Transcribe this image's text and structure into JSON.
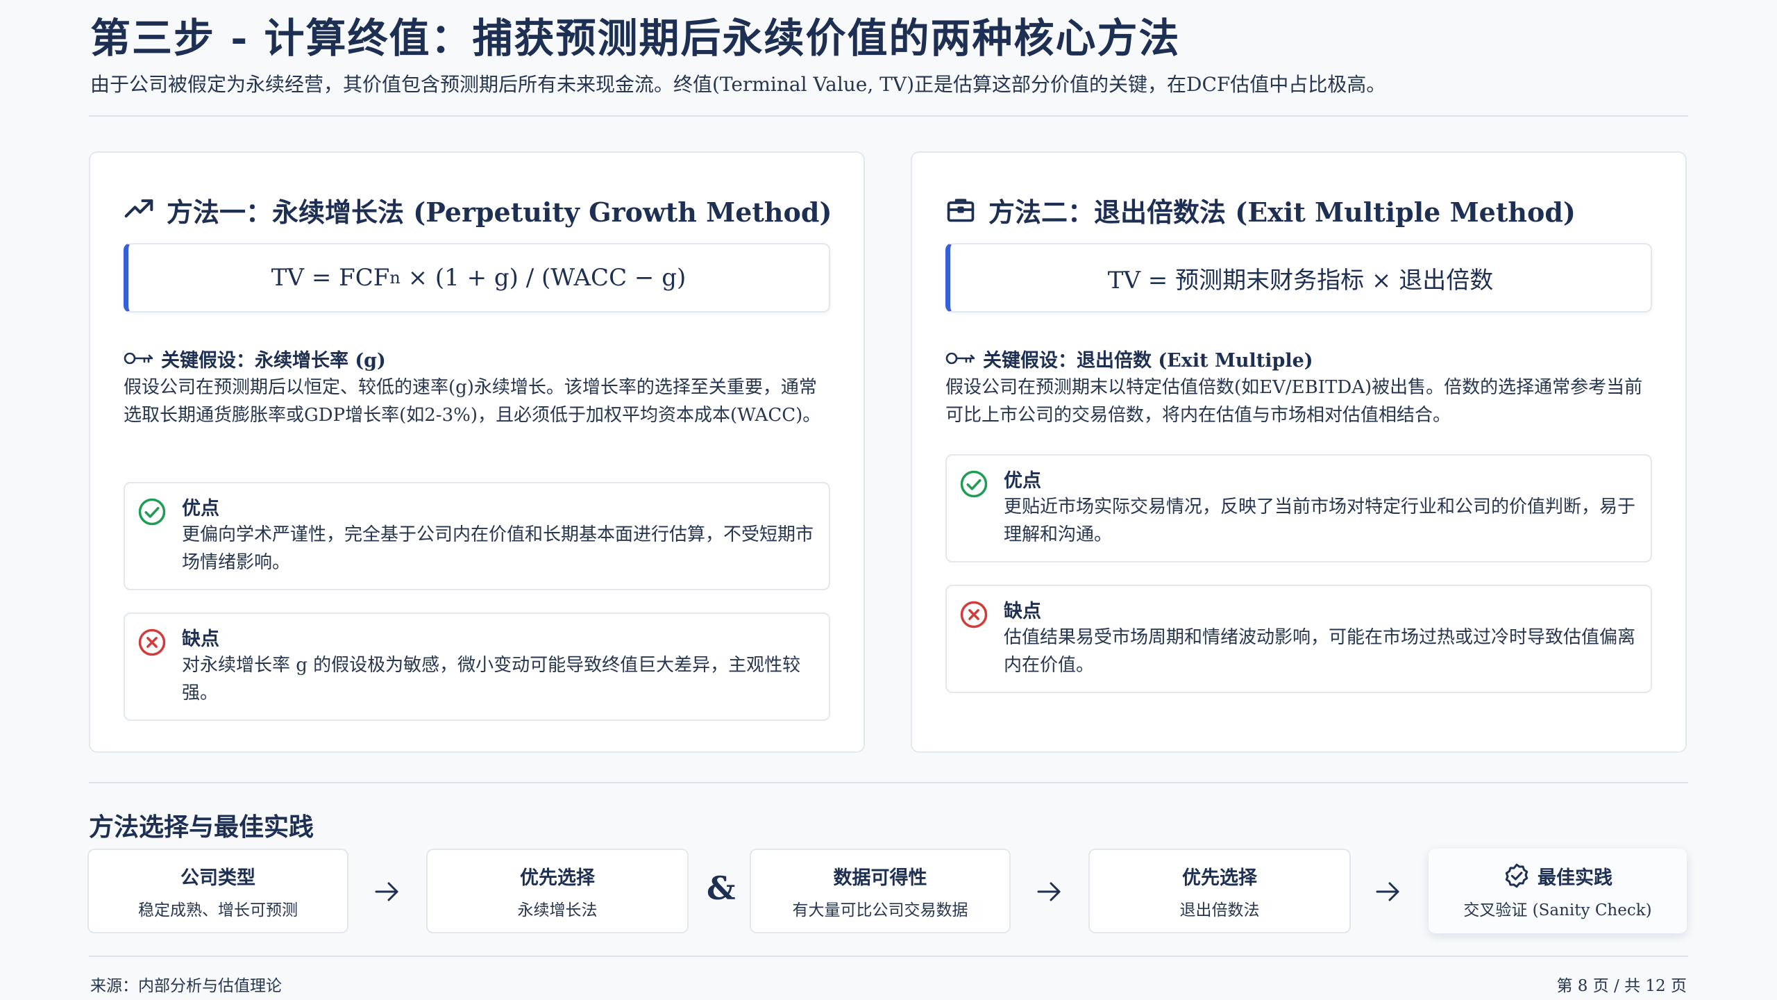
{
  "header": {
    "title": "第三步 - 计算终值：捕获预测期后永续价值的两种核心方法",
    "subtitle": "由于公司被假定为永续经营，其价值包含预测期后所有未来现金流。终值(Terminal Value, TV)正是估算这部分价值的关键，在DCF估值中占比极高。"
  },
  "method1": {
    "icon": "trending-up-icon",
    "title": "方法一：永续增长法 (Perpetuity Growth Method)",
    "formula_pre": "TV = FCF",
    "formula_sub": "n",
    "formula_post": " × (1 + g) / (WACC − g)",
    "assumption_label": "关键假设：永续增长率 (g)",
    "assumption_text": "假设公司在预测期后以恒定、较低的速率(g)永续增长。该增长率的选择至关重要，通常选取长期通货膨胀率或GDP增长率(如2-3%)，且必须低于加权平均资本成本(WACC)。",
    "pros_title": "优点",
    "pros_text": "更偏向学术严谨性，完全基于公司内在价值和长期基本面进行估算，不受短期市场情绪影响。",
    "cons_title": "缺点",
    "cons_text": "对永续增长率 g 的假设极为敏感，微小变动可能导致终值巨大差异，主观性较强。"
  },
  "method2": {
    "icon": "briefcase-icon",
    "title": "方法二：退出倍数法 (Exit Multiple Method)",
    "formula": "TV = 预测期末财务指标 × 退出倍数",
    "assumption_label": "关键假设：退出倍数 (Exit Multiple)",
    "assumption_text": "假设公司在预测期末以特定估值倍数(如EV/EBITDA)被出售。倍数的选择通常参考当前可比上市公司的交易倍数，将内在估值与市场相对估值相结合。",
    "pros_title": "优点",
    "pros_text": "更贴近市场实际交易情况，反映了当前市场对特定行业和公司的价值判断，易于理解和沟通。",
    "cons_title": "缺点",
    "cons_text": "估值结果易受市场周期和情绪波动影响，可能在市场过热或过冷时导致估值偏离内在价值。"
  },
  "best_practice": {
    "title": "方法选择与最佳实践",
    "ampersand": "&",
    "steps": [
      {
        "title": "公司类型",
        "sub": "稳定成熟、增长可预测"
      },
      {
        "title": "优先选择",
        "sub": "永续增长法"
      },
      {
        "title": "数据可得性",
        "sub": "有大量可比公司交易数据"
      },
      {
        "title": "优先选择",
        "sub": "退出倍数法"
      },
      {
        "title": "最佳实践",
        "sub": "交叉验证 (Sanity Check)"
      }
    ]
  },
  "footer": {
    "source": "来源：内部分析与估值理论",
    "page": "第 8 页 / 共 12 页"
  },
  "colors": {
    "accent": "#3760d8",
    "pros": "#1f9d55",
    "cons": "#d33a3a",
    "text": "#1d2f52"
  }
}
